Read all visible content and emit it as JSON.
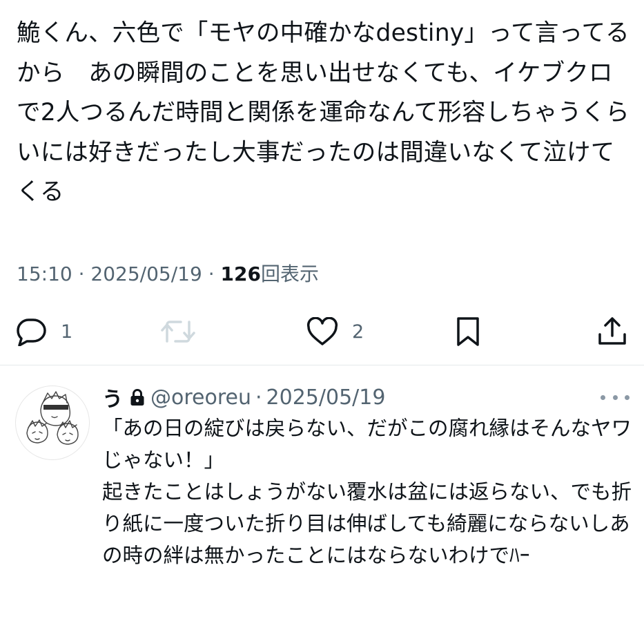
{
  "tweet": {
    "text": "鮠くん、六色で「モヤの中確かなdestiny」って言ってるから　あの瞬間のことを思い出せなくても、イケブクロで2人つるんだ時間と関係を運命なんて形容しちゃうくらいには好きだったし大事だったのは間違いなくて泣けてくる",
    "time": "15:10",
    "date": "2025/05/19",
    "separator": "·",
    "views_count": "126",
    "views_label": "回表示",
    "actions": {
      "reply_icon": "reply-icon",
      "reply_count": "1",
      "retweet_icon": "retweet-icon",
      "retweet_count": "",
      "like_icon": "heart-icon",
      "like_count": "2",
      "bookmark_icon": "bookmark-icon",
      "share_icon": "share-icon"
    }
  },
  "reply": {
    "display_name": "う",
    "protected_icon": "lock-icon",
    "handle": "@oreoreu",
    "separator": "·",
    "date": "2025/05/19",
    "more_icon": "more-icon",
    "text": "「あの日の綻びは戻らない、だがこの腐れ縁はそんなヤワじゃない！」\n起きたことはしょうがない覆水は盆には返らない、でも折り紙に一度ついた折り目は伸ばしても綺麗にならないしあの時の絆は無かったことにはならないわけでﾊｰ"
  },
  "colors": {
    "text": "#0f1419",
    "secondary": "#536471",
    "retweet_disabled": "#cfd9de",
    "divider": "#e4e8eb"
  }
}
